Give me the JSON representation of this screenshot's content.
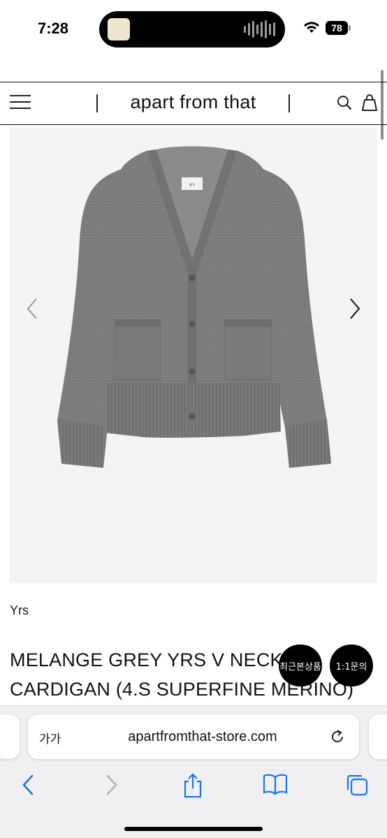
{
  "status_bar": {
    "time": "7:28",
    "battery": "78"
  },
  "site_header": {
    "brand": "apart from that",
    "menu_icon": "hamburger-menu-icon",
    "search_icon": "search-icon",
    "cart_icon": "shopping-bag-icon"
  },
  "product": {
    "image_label": "yrs",
    "brand": "Yrs",
    "title": "MELANGE GREY YRS V NECK CARDIGAN (4.S SUPERFINE MERINO)"
  },
  "floating_buttons": {
    "recent": "최근본상품",
    "inquiry": "1:1문의"
  },
  "safari": {
    "text_size": "가가",
    "url": "apartfromthat-store.com"
  },
  "colors": {
    "accent_blue": "#1a73e8",
    "cardigan_grey": "#7d7d7d"
  }
}
